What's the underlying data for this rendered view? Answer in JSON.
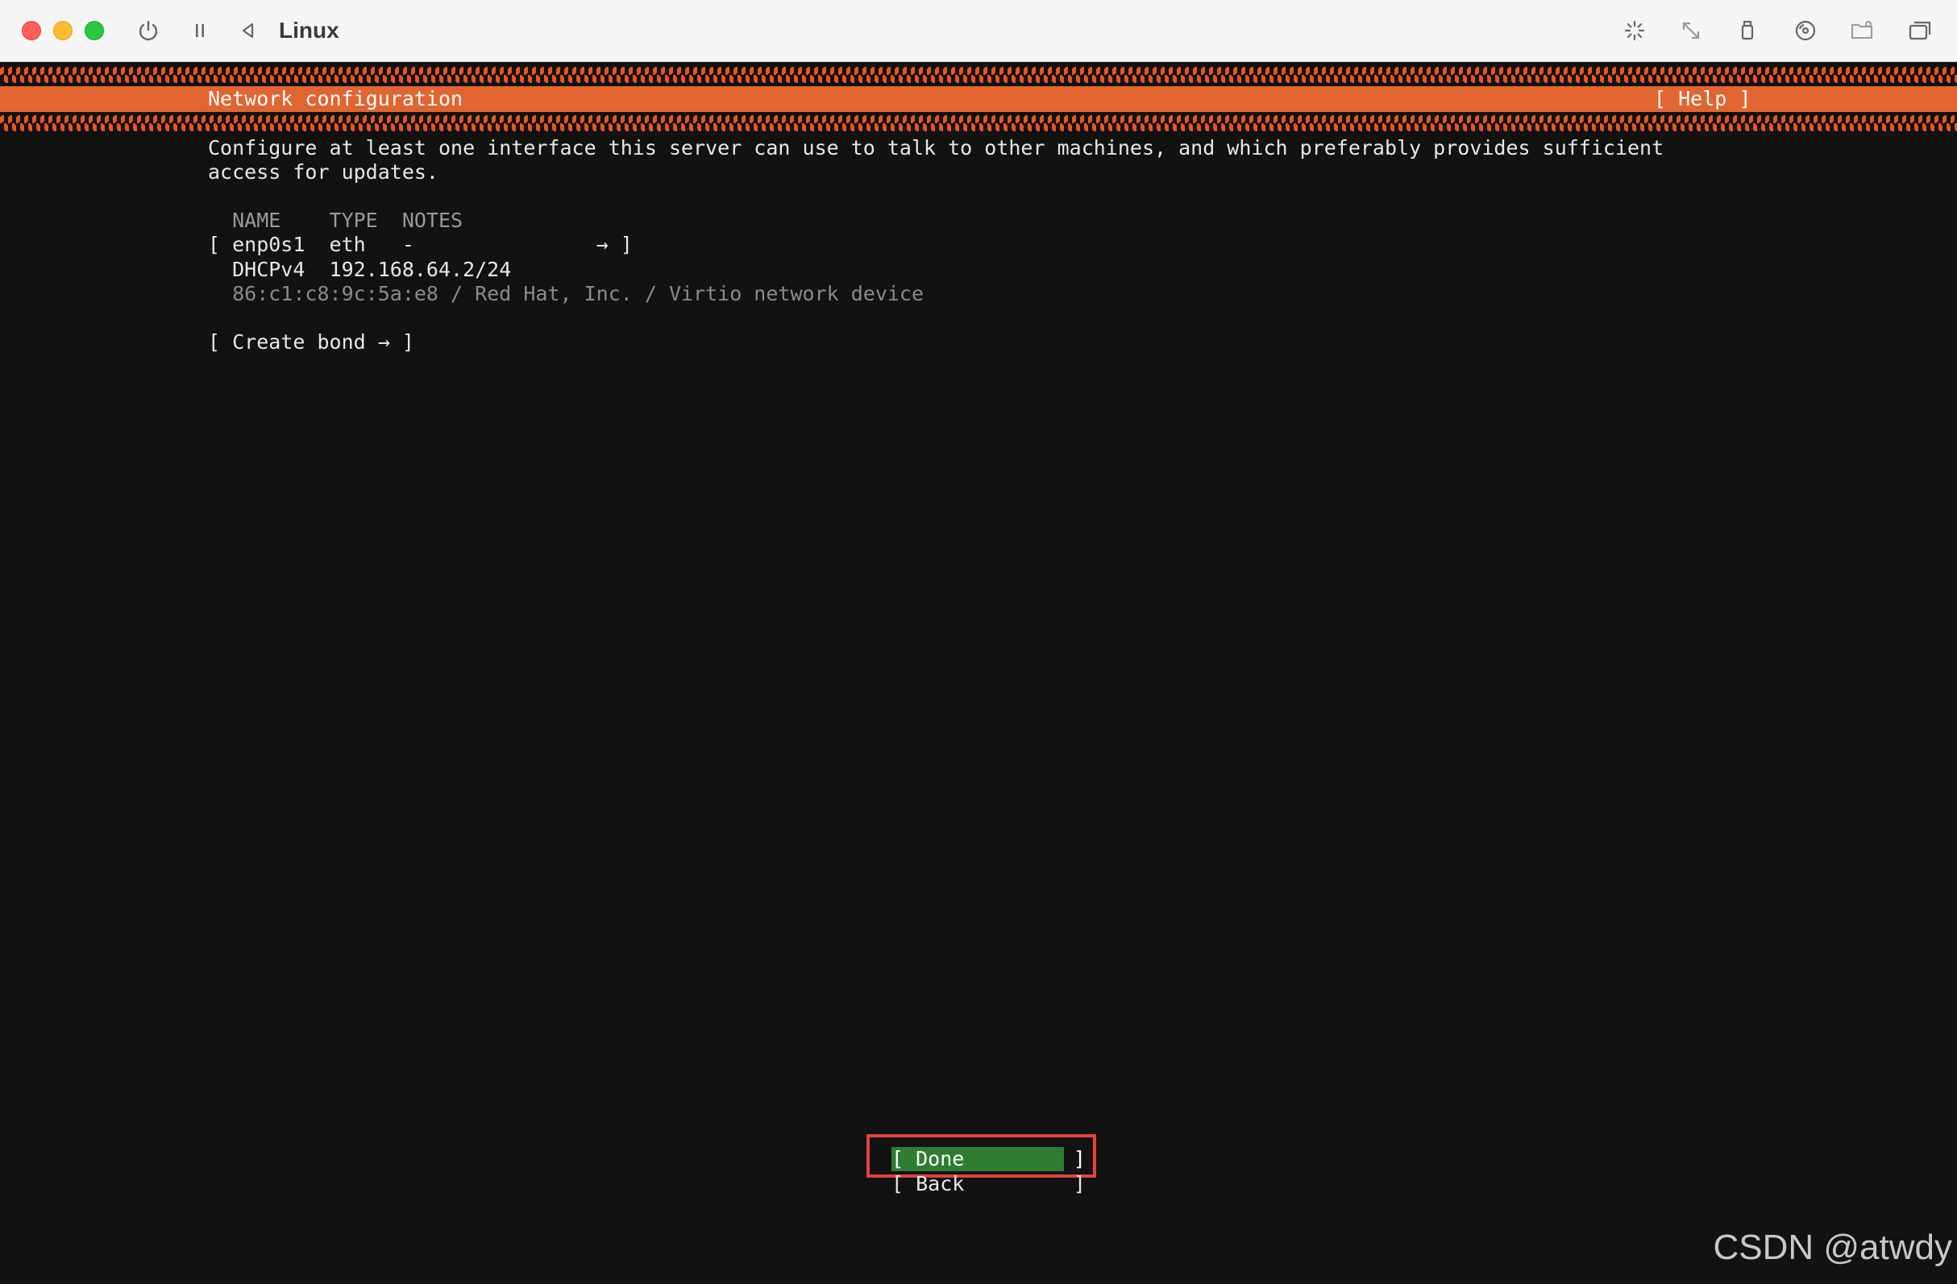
{
  "window": {
    "title": "Linux",
    "traffic_lights": [
      "close",
      "minimize",
      "zoom"
    ],
    "toolbar_left_icons": [
      "power-icon",
      "pause-icon",
      "back-icon"
    ],
    "toolbar_right_icons": [
      "activity-icon",
      "resize-icon",
      "usb-icon",
      "disc-icon",
      "shared-folder-icon",
      "display-icon"
    ]
  },
  "installer": {
    "screen_title": "Network configuration",
    "help_label": "[ Help ]",
    "description": [
      "Configure at least one interface this server can use to talk to other machines, and which preferably provides sufficient",
      "access for updates."
    ],
    "table_header": "  NAME    TYPE  NOTES",
    "interface": {
      "row": "[ enp0s1  eth   -               → ]",
      "dhcp": "  DHCPv4  192.168.64.2/24",
      "hw_info": "  86:c1:c8:9c:5a:e8 / Red Hat, Inc. / Virtio network device"
    },
    "create_bond": "[ Create bond → ]",
    "buttons": {
      "done": "[ Done         ]",
      "back": "[ Back         ]"
    }
  },
  "colors": {
    "accent_orange": "#e16530",
    "done_green": "#2e7d32",
    "highlight_red": "#e0443e",
    "terminal_bg": "#121212"
  },
  "watermark": "CSDN @atwdy"
}
